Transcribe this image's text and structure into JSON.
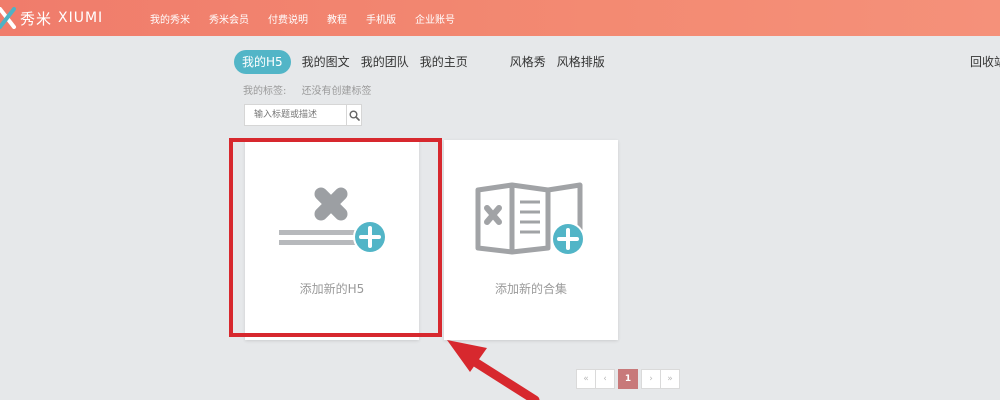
{
  "brand": {
    "name_cn": "秀米",
    "name_en": "XIUMI"
  },
  "nav": [
    "我的秀米",
    "秀米会员",
    "付费说明",
    "教程",
    "手机版",
    "企业账号"
  ],
  "tabs": [
    "我的H5",
    "我的图文",
    "我的团队",
    "我的主页",
    "风格秀",
    "风格排版"
  ],
  "top_right": "回收站",
  "tags": {
    "label": "我的标签:",
    "empty": "还没有创建标签"
  },
  "search": {
    "placeholder": "输入标题或描述"
  },
  "cards": {
    "new_h5": "添加新的H5",
    "new_collection": "添加新的合集"
  },
  "pagination": {
    "first": "«",
    "prev": "‹",
    "current": "1",
    "next": "›",
    "last": "»"
  },
  "colors": {
    "accent": "#52b5c7",
    "highlight": "#d7282e",
    "header": "#f38a72"
  }
}
